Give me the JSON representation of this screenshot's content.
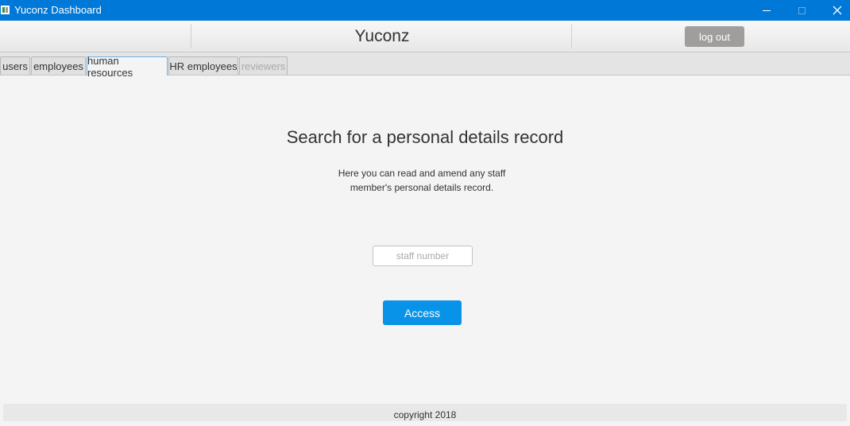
{
  "window": {
    "title": "Yuconz Dashboard",
    "icon": "app-icon",
    "controls": [
      "minimize-icon",
      "maximize-icon",
      "close-icon"
    ]
  },
  "header": {
    "brand": "Yuconz",
    "logout_label": "log out"
  },
  "tabs": [
    {
      "label": "users",
      "state": "normal"
    },
    {
      "label": "employees",
      "state": "normal"
    },
    {
      "label": "human resources",
      "state": "active"
    },
    {
      "label": "HR employees",
      "state": "normal"
    },
    {
      "label": "reviewers",
      "state": "disabled"
    }
  ],
  "main": {
    "heading": "Search for a personal details record",
    "description_line1": "Here you can read and amend any staff",
    "description_line2": "member's personal details record.",
    "staff_number": {
      "value": "",
      "placeholder": "staff number"
    },
    "access_label": "Access"
  },
  "footer": {
    "text": "copyright 2018"
  },
  "colors": {
    "titlebar": "#0078d7",
    "access_button": "#0993e8",
    "logout_button": "#a09e9c",
    "active_tab_border": "#6fb0e3"
  }
}
